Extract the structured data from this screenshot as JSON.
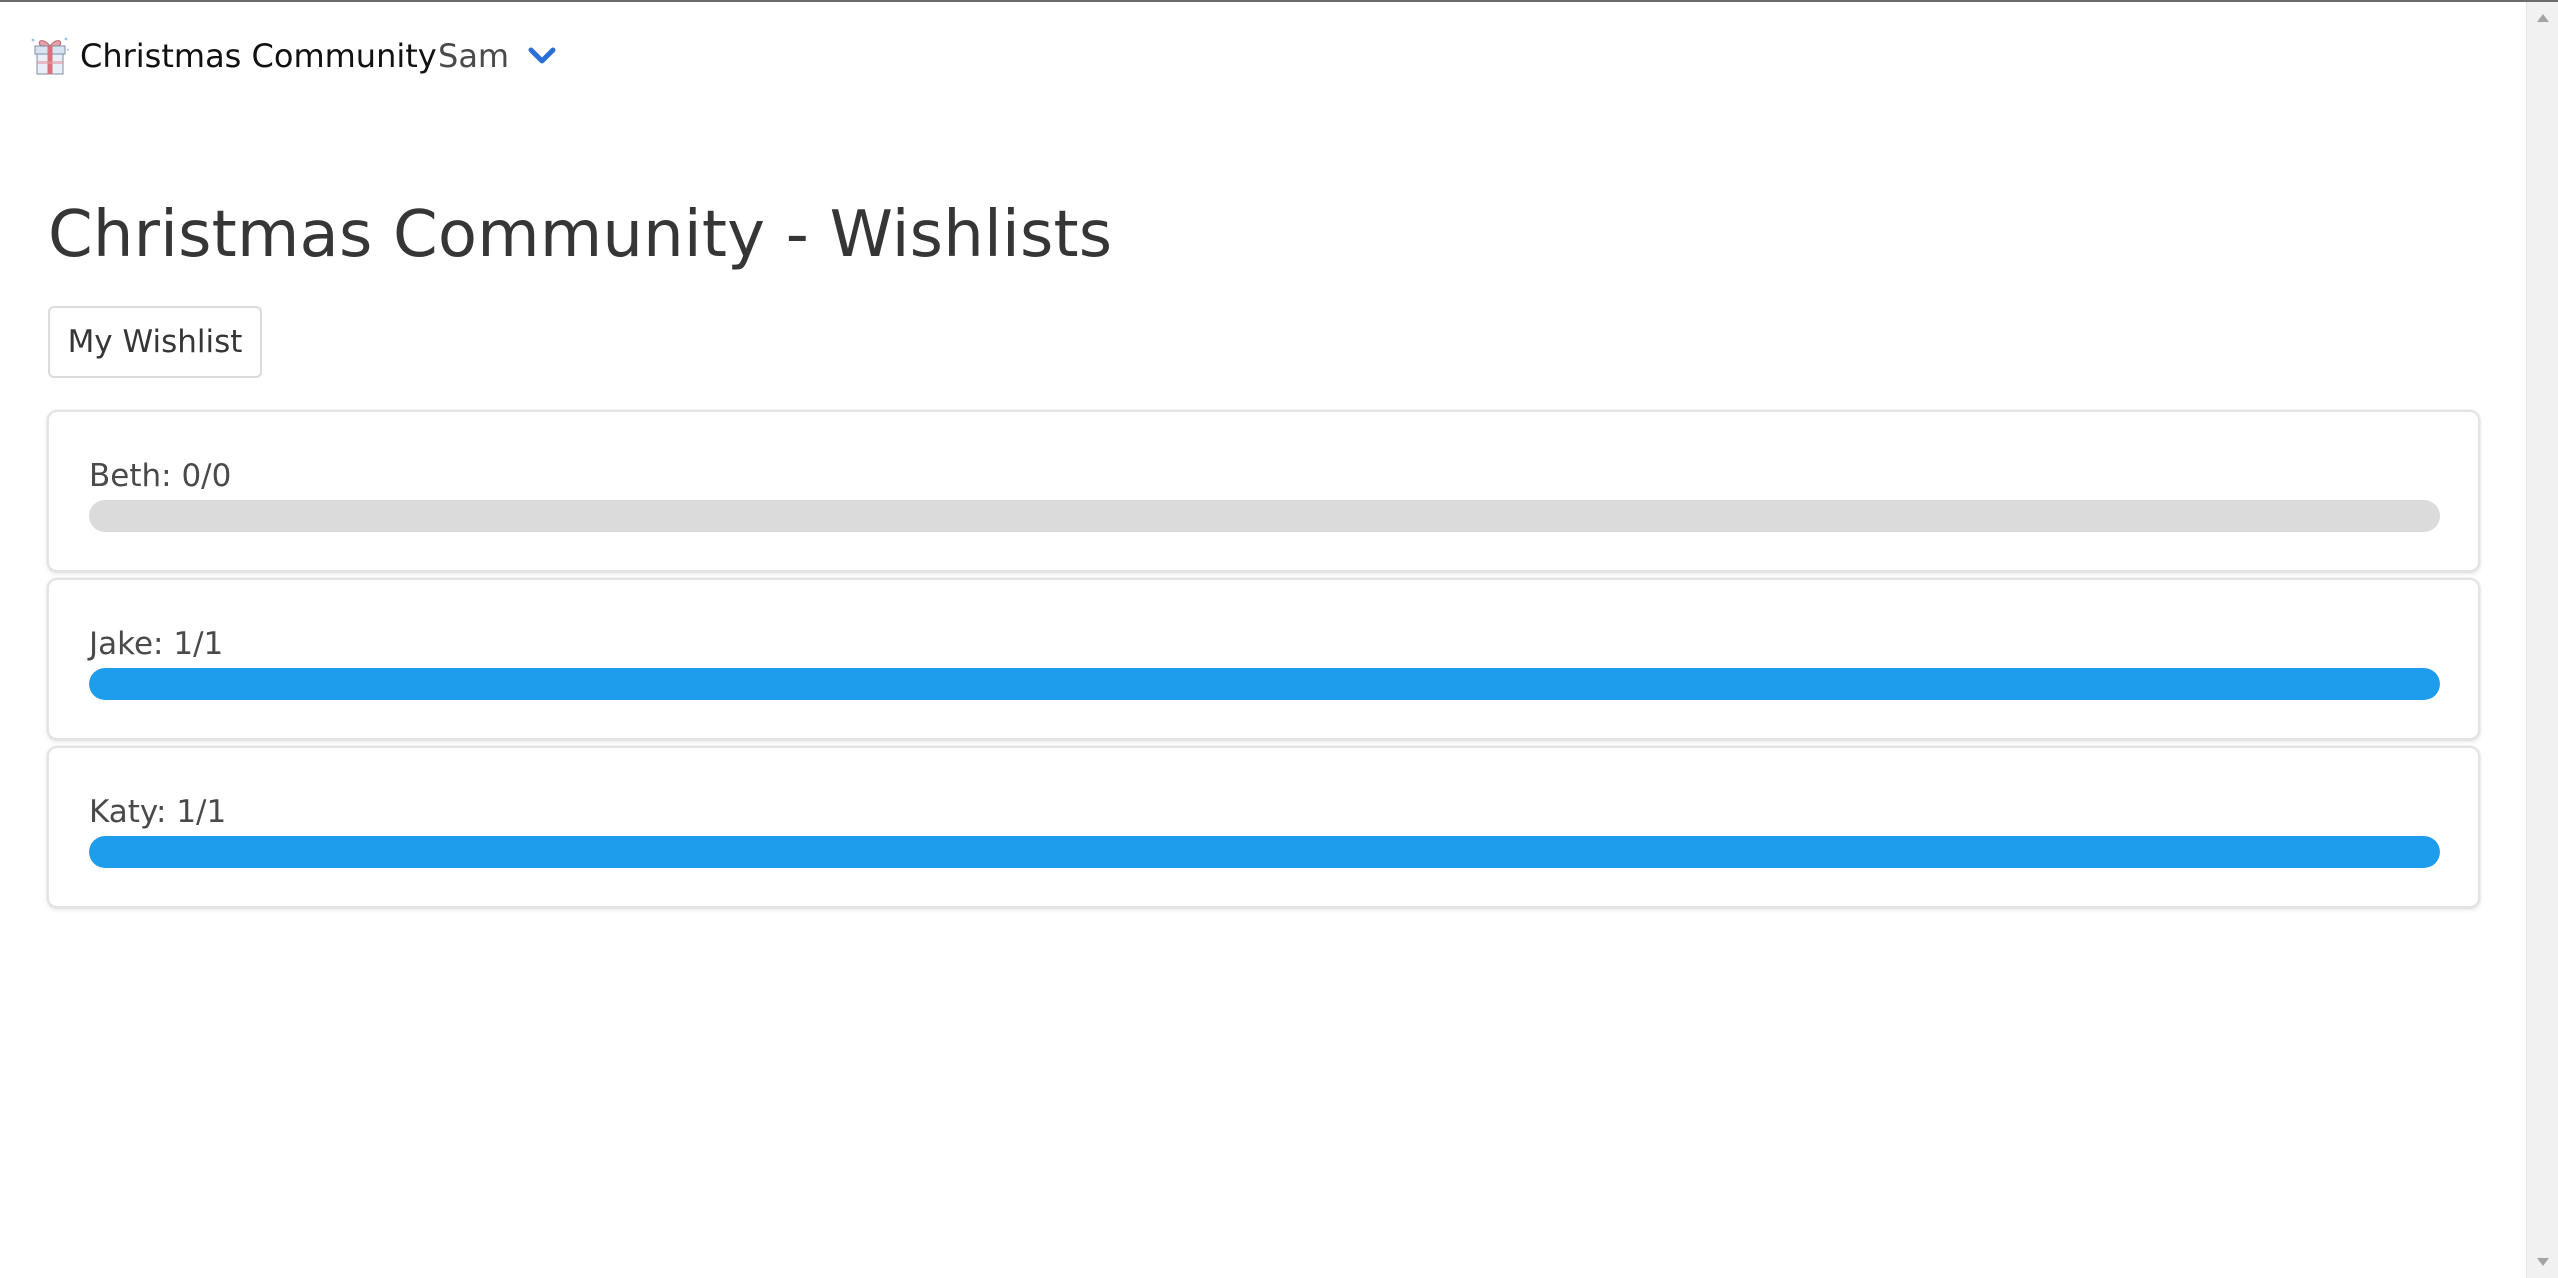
{
  "navbar": {
    "brand_text": "Christmas Community",
    "brand_icon": "gift-icon",
    "user_name": "Sam",
    "user_menu_icon": "chevron-down-icon"
  },
  "main": {
    "title": "Christmas Community - Wishlists",
    "my_wishlist_label": "My Wishlist",
    "wishlists": [
      {
        "label": "Beth: 0/0",
        "progress": 0
      },
      {
        "label": "Jake: 1/1",
        "progress": 1
      },
      {
        "label": "Katy: 1/1",
        "progress": 1
      }
    ]
  },
  "colors": {
    "accent": "#1f9ded",
    "progress_track": "#dbdbdb",
    "chevron": "#2b6fd6",
    "title": "#363636"
  }
}
